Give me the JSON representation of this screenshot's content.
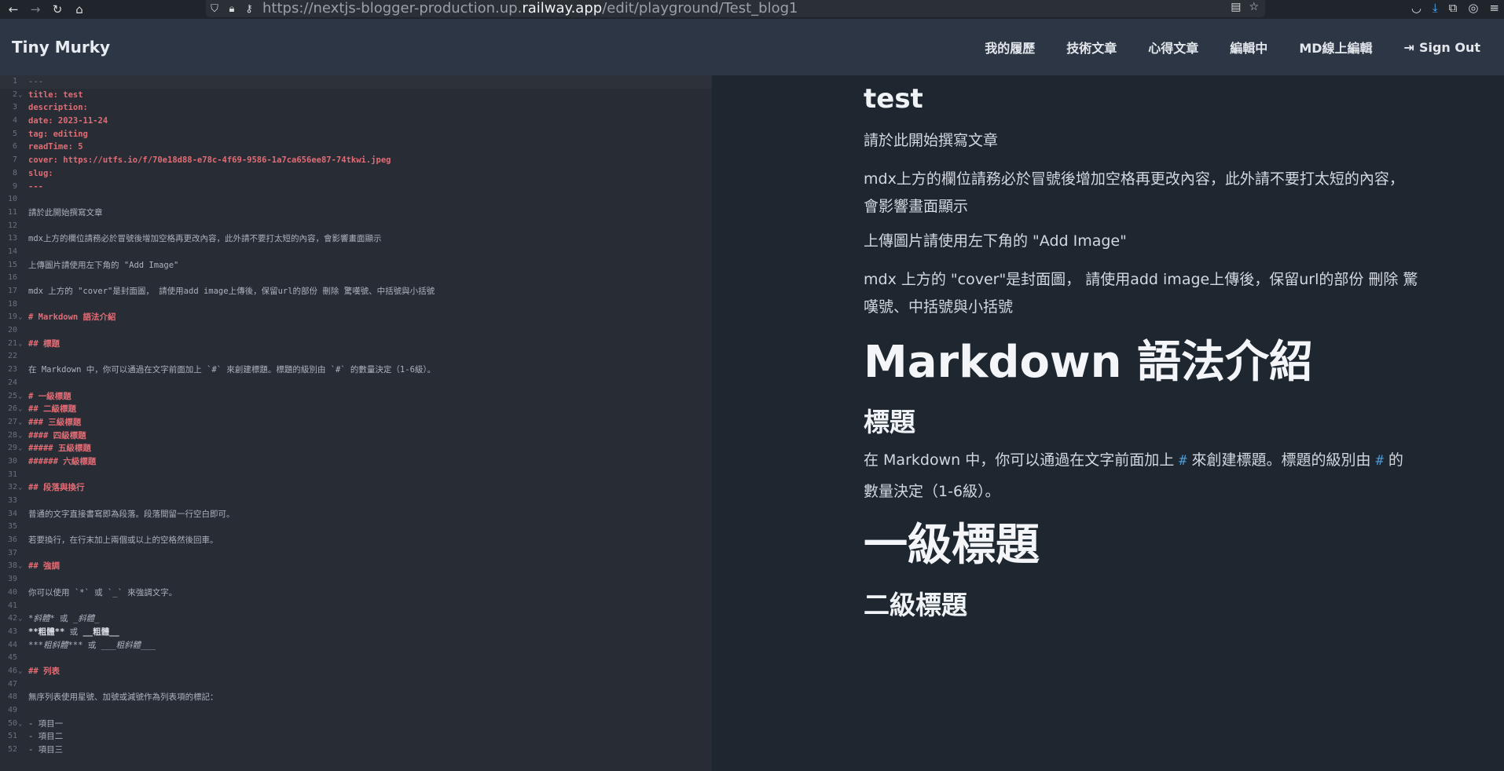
{
  "browser": {
    "url_prefix": "https://nextjs-blogger-production.up.",
    "url_domain": "railway.app",
    "url_path": "/edit/playground/Test_blog1"
  },
  "header": {
    "brand": "Tiny Murky",
    "nav": [
      "我的履歷",
      "技術文章",
      "心得文章",
      "編輯中",
      "MD線上編輯"
    ],
    "signout": "Sign Out"
  },
  "editor": {
    "lines": [
      {
        "n": "1",
        "fold": "",
        "parts": [
          [
            "dash",
            "---"
          ]
        ]
      },
      {
        "n": "2",
        "fold": "⌄",
        "parts": [
          [
            "key",
            "title: test"
          ]
        ]
      },
      {
        "n": "3",
        "fold": "",
        "parts": [
          [
            "key",
            "description:"
          ]
        ]
      },
      {
        "n": "4",
        "fold": "",
        "parts": [
          [
            "key",
            "date: 2023-11-24"
          ]
        ]
      },
      {
        "n": "5",
        "fold": "",
        "parts": [
          [
            "key",
            "tag: editing"
          ]
        ]
      },
      {
        "n": "6",
        "fold": "",
        "parts": [
          [
            "key",
            "readTime: 5"
          ]
        ]
      },
      {
        "n": "7",
        "fold": "",
        "parts": [
          [
            "key",
            "cover: https://utfs.io/f/70e18d88-e78c-4f69-9586-1a7ca656ee87-74tkwi.jpeg"
          ]
        ]
      },
      {
        "n": "8",
        "fold": "",
        "parts": [
          [
            "key",
            "slug:"
          ]
        ]
      },
      {
        "n": "9",
        "fold": "",
        "parts": [
          [
            "key",
            "---"
          ]
        ]
      },
      {
        "n": "10",
        "fold": "",
        "parts": []
      },
      {
        "n": "11",
        "fold": "",
        "parts": [
          [
            "txt",
            "請於此開始撰寫文章"
          ]
        ]
      },
      {
        "n": "12",
        "fold": "",
        "parts": []
      },
      {
        "n": "13",
        "fold": "",
        "parts": [
          [
            "txt",
            "mdx上方的欄位請務必於冒號後增加空格再更改內容，此外請不要打太短的內容，會影響畫面顯示"
          ]
        ]
      },
      {
        "n": "14",
        "fold": "",
        "parts": []
      },
      {
        "n": "15",
        "fold": "",
        "parts": [
          [
            "txt",
            "上傳圖片請使用左下角的 \"Add Image\""
          ]
        ]
      },
      {
        "n": "16",
        "fold": "",
        "parts": []
      },
      {
        "n": "17",
        "fold": "",
        "parts": [
          [
            "txt",
            "mdx 上方的 \"cover\"是封面圖， 請使用add image上傳後，保留url的部份 刪除 驚嘆號、中括號與小括號"
          ]
        ]
      },
      {
        "n": "18",
        "fold": "",
        "parts": []
      },
      {
        "n": "19",
        "fold": "⌄",
        "parts": [
          [
            "hmark",
            "# "
          ],
          [
            "htext",
            "Markdown 語法介紹"
          ]
        ]
      },
      {
        "n": "20",
        "fold": "",
        "parts": []
      },
      {
        "n": "21",
        "fold": "⌄",
        "parts": [
          [
            "hmark",
            "## "
          ],
          [
            "htext",
            "標題"
          ]
        ]
      },
      {
        "n": "22",
        "fold": "",
        "parts": []
      },
      {
        "n": "23",
        "fold": "",
        "parts": [
          [
            "txt",
            "在 Markdown 中，你可以通過在文字前面加上 `#` 來創建標題。標題的級別由 `#` 的數量決定（1-6級）。"
          ]
        ]
      },
      {
        "n": "24",
        "fold": "",
        "parts": []
      },
      {
        "n": "25",
        "fold": "⌄",
        "parts": [
          [
            "hmark",
            "# "
          ],
          [
            "htext",
            "一級標題"
          ]
        ]
      },
      {
        "n": "26",
        "fold": "⌄",
        "parts": [
          [
            "hmark",
            "## "
          ],
          [
            "htext",
            "二級標題"
          ]
        ]
      },
      {
        "n": "27",
        "fold": "⌄",
        "parts": [
          [
            "hmark",
            "### "
          ],
          [
            "htext",
            "三級標題"
          ]
        ]
      },
      {
        "n": "28",
        "fold": "⌄",
        "parts": [
          [
            "hmark",
            "#### "
          ],
          [
            "htext",
            "四級標題"
          ]
        ]
      },
      {
        "n": "29",
        "fold": "⌄",
        "parts": [
          [
            "hmark",
            "##### "
          ],
          [
            "htext",
            "五級標題"
          ]
        ]
      },
      {
        "n": "30",
        "fold": "",
        "parts": [
          [
            "hmark",
            "###### "
          ],
          [
            "htext",
            "六級標題"
          ]
        ]
      },
      {
        "n": "31",
        "fold": "",
        "parts": []
      },
      {
        "n": "32",
        "fold": "⌄",
        "parts": [
          [
            "hmark",
            "## "
          ],
          [
            "htext",
            "段落與換行"
          ]
        ]
      },
      {
        "n": "33",
        "fold": "",
        "parts": []
      },
      {
        "n": "34",
        "fold": "",
        "parts": [
          [
            "txt",
            "普通的文字直接書寫即為段落。段落間留一行空白即可。"
          ]
        ]
      },
      {
        "n": "35",
        "fold": "",
        "parts": []
      },
      {
        "n": "36",
        "fold": "",
        "parts": [
          [
            "txt",
            "若要換行，在行末加上兩個或以上的空格然後回車。"
          ]
        ]
      },
      {
        "n": "37",
        "fold": "",
        "parts": []
      },
      {
        "n": "38",
        "fold": "⌄",
        "parts": [
          [
            "hmark",
            "## "
          ],
          [
            "htext",
            "強調"
          ]
        ]
      },
      {
        "n": "39",
        "fold": "",
        "parts": []
      },
      {
        "n": "40",
        "fold": "",
        "parts": [
          [
            "txt",
            "你可以使用 `*` 或 `_` 來強調文字。"
          ]
        ]
      },
      {
        "n": "41",
        "fold": "",
        "parts": []
      },
      {
        "n": "42",
        "fold": "⌄",
        "parts": [
          [
            "em",
            "*斜體*"
          ],
          [
            "txt",
            " 或 "
          ],
          [
            "em",
            "_斜體_"
          ]
        ]
      },
      {
        "n": "43",
        "fold": "",
        "parts": [
          [
            "strong",
            "**粗體**"
          ],
          [
            "txt",
            " 或 "
          ],
          [
            "strong",
            "__粗體__"
          ]
        ]
      },
      {
        "n": "44",
        "fold": "",
        "parts": [
          [
            "em",
            "***粗斜體***"
          ],
          [
            "txt",
            " 或 "
          ],
          [
            "em",
            "___粗斜體___"
          ]
        ]
      },
      {
        "n": "45",
        "fold": "",
        "parts": []
      },
      {
        "n": "46",
        "fold": "⌄",
        "parts": [
          [
            "hmark",
            "## "
          ],
          [
            "htext",
            "列表"
          ]
        ]
      },
      {
        "n": "47",
        "fold": "",
        "parts": []
      },
      {
        "n": "48",
        "fold": "",
        "parts": [
          [
            "txt",
            "無序列表使用星號、加號或減號作為列表項的標記："
          ]
        ]
      },
      {
        "n": "49",
        "fold": "",
        "parts": []
      },
      {
        "n": "50",
        "fold": "⌄",
        "parts": [
          [
            "list",
            "- 項目一"
          ]
        ]
      },
      {
        "n": "51",
        "fold": "",
        "parts": [
          [
            "list",
            "- 項目二"
          ]
        ]
      },
      {
        "n": "52",
        "fold": "",
        "parts": [
          [
            "list",
            "- 項目三"
          ]
        ]
      }
    ]
  },
  "preview": {
    "title": "test",
    "p1": "請於此開始撰寫文章",
    "p2a": "mdx上方的欄位請務必於冒號後增加空格再更改內容，此外請不要打太短的內容，",
    "p2b": "會影響畫面顯示",
    "p3": "上傳圖片請使用左下角的 \"Add Image\"",
    "p4a": "mdx 上方的 \"cover\"是封面圖， 請使用add image上傳後，保留url的部份 刪除 驚",
    "p4b": "嘆號、中括號與小括號",
    "h1": "Markdown 語法介紹",
    "h2": "標題",
    "p5a": "在 Markdown 中，你可以通過在文字前面加上 ",
    "p5hash1": "#",
    "p5b": " 來創建標題。標題的級別由 ",
    "p5hash2": "#",
    "p5c": " 的",
    "p5d": "數量決定（1-6級）。",
    "h1b": "一級標題",
    "h2b": "二級標題"
  }
}
